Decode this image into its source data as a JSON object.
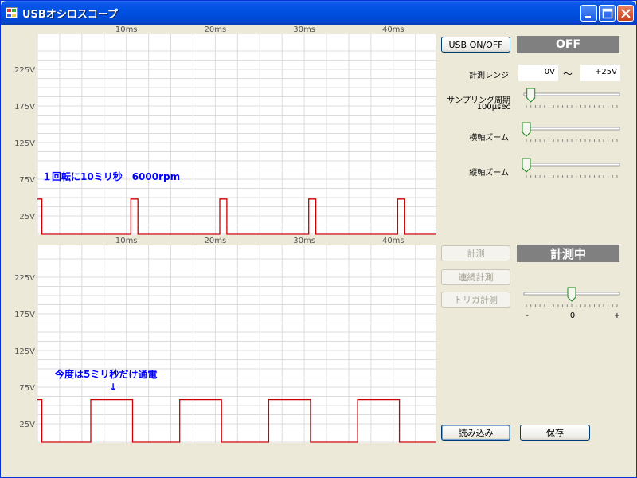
{
  "window": {
    "title": "USBオシロスコープ"
  },
  "charts": {
    "x_labels": [
      "10ms",
      "20ms",
      "30ms",
      "40ms"
    ],
    "y_labels": [
      "225V",
      "175V",
      "125V",
      "75V",
      "25V"
    ],
    "top_annotation": "１回転に10ミリ秒　6000rpm",
    "bottom_annotation": "今度は5ミリ秒だけ通電",
    "bottom_arrow": "↓"
  },
  "chart_data": [
    {
      "type": "line",
      "x": [
        0,
        0.5,
        0.5,
        10.5,
        10.5,
        11.3,
        11.3,
        20.5,
        20.5,
        21.3,
        21.3,
        30.5,
        30.5,
        31.3,
        31.3,
        40.5,
        40.5,
        41.3,
        41.3,
        45
      ],
      "y": [
        48,
        48,
        0,
        0,
        48,
        48,
        0,
        0,
        48,
        48,
        0,
        0,
        48,
        48,
        0,
        0,
        48,
        48,
        0,
        0
      ],
      "series": [
        {
          "color": "#cc0000"
        }
      ],
      "xlabel": "",
      "ylabel": "",
      "xticks": [
        "10ms",
        "20ms",
        "30ms",
        "40ms"
      ],
      "yticks": [
        "25V",
        "75V",
        "125V",
        "175V",
        "225V"
      ],
      "grid": true,
      "annotations": [
        "１回転に10ミリ秒　6000rpm"
      ]
    },
    {
      "type": "line",
      "x": [
        0,
        0.5,
        0.5,
        6,
        6,
        10.7,
        10.7,
        16,
        16,
        20.7,
        20.7,
        26,
        26,
        30.7,
        30.7,
        36,
        36,
        40.7,
        40.7,
        45
      ],
      "y": [
        58,
        58,
        0,
        0,
        58,
        58,
        0,
        0,
        58,
        58,
        0,
        0,
        58,
        58,
        0,
        0,
        58,
        58,
        0,
        0
      ],
      "series": [
        {
          "color": "#cc0000"
        }
      ],
      "xlabel": "",
      "ylabel": "",
      "xticks": [
        "10ms",
        "20ms",
        "30ms",
        "40ms"
      ],
      "yticks": [
        "25V",
        "75V",
        "125V",
        "175V",
        "225V"
      ],
      "grid": true,
      "annotations": [
        "今度は5ミリ秒だけ通電",
        "↓"
      ]
    }
  ],
  "controls": {
    "usb_button": "USB ON/OFF",
    "usb_status": "OFF",
    "range_label": "計測レンジ",
    "range_min": "0V",
    "range_sep": "～",
    "range_max": "+25V",
    "sampling_label": "サンプリング周期",
    "sampling_value": "100μsec",
    "h_zoom_label": "横軸ズーム",
    "v_zoom_label": "縦軸ズーム",
    "measure_button": "計測",
    "measure_status": "計測中",
    "continuous_button": "連続計測",
    "trigger_button": "トリガ計測",
    "trigger_min": "-",
    "trigger_mid": "0",
    "trigger_max": "+",
    "trigger_level": 0.5,
    "sampling_level": 0.05,
    "h_zoom_level": 0,
    "v_zoom_level": 0,
    "load_button": "読み込み",
    "save_button": "保存"
  }
}
